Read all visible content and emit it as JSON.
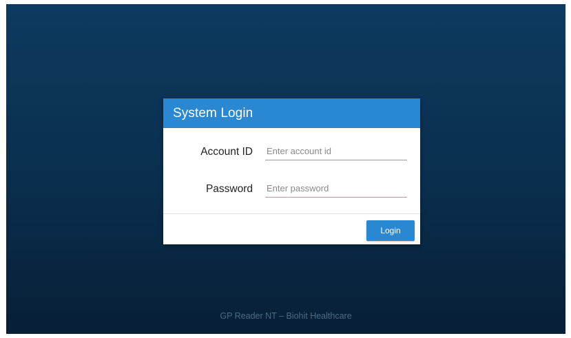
{
  "dialog": {
    "title": "System Login",
    "account": {
      "label": "Account ID",
      "value": "",
      "placeholder": "Enter account id"
    },
    "password": {
      "label": "Password",
      "value": "",
      "placeholder": "Enter password"
    },
    "login_label": "Login"
  },
  "footer": {
    "text": "GP Reader NT – Biohit Healthcare"
  },
  "colors": {
    "accent": "#2a87d2",
    "background_top": "#0d3a60",
    "background_bottom": "#071f36"
  }
}
